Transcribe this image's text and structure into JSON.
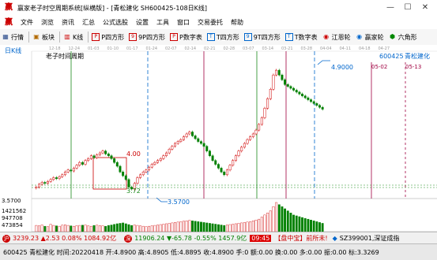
{
  "window": {
    "title": "赢家老子时空周期系统[纵横版] - [青松建化  SH600425-108日K线]"
  },
  "menu": [
    "文件",
    "浏览",
    "资讯",
    "汇总",
    "公式选股",
    "设置",
    "工具",
    "窗口",
    "交易委托",
    "帮助"
  ],
  "toolbar": [
    {
      "label": "行情",
      "icon": "grid-icon"
    },
    {
      "label": "板块",
      "icon": "blocks-icon"
    },
    {
      "label": "K线",
      "icon": "kline-icon"
    },
    {
      "label": "P四方形",
      "icon": "p-square-icon"
    },
    {
      "label": "9P四方形",
      "icon": "9p-square-icon"
    },
    {
      "label": "P数字表",
      "icon": "p-table-icon"
    },
    {
      "label": "T四方形",
      "icon": "t-square-icon"
    },
    {
      "label": "9T四方形",
      "icon": "9t-square-icon"
    },
    {
      "label": "T数字表",
      "icon": "t-table-icon"
    },
    {
      "label": "江恩轮",
      "icon": "gann-wheel-icon"
    },
    {
      "label": "赢家轮",
      "icon": "winner-wheel-icon"
    },
    {
      "label": "六角形",
      "icon": "hexagon-icon"
    }
  ],
  "chart": {
    "period_label": "日K线",
    "cycle_label": "老子时间周期",
    "stock_code": "600425",
    "stock_name": "青松建化",
    "top_dates": [
      "12-18",
      "12-24",
      "01-03",
      "01-10",
      "01-17",
      "01-24",
      "02-07",
      "02-14",
      "02-21",
      "02-28",
      "03-07",
      "03-14",
      "03-21",
      "03-28",
      "04-04",
      "04-11",
      "04-18",
      "04-27"
    ],
    "date_labels": [
      {
        "text": "05-02"
      },
      {
        "text": "05-13"
      }
    ],
    "price_labels": {
      "high": "4.9000",
      "box_top": "4.00",
      "box_bottom": "3.72",
      "low": "3.5700",
      "axis_low": "3.5700"
    },
    "volume_axis": [
      "1421562",
      "947708",
      "473854"
    ]
  },
  "chart_data": {
    "type": "candlestick",
    "x": [
      1,
      2,
      3,
      4,
      5,
      6,
      7,
      8,
      9,
      10,
      11,
      12,
      13,
      14,
      15,
      16,
      17,
      18,
      19,
      20,
      21,
      22,
      23,
      24,
      25,
      26,
      27,
      28,
      29,
      30,
      31,
      32,
      33,
      34,
      35,
      36,
      37,
      38,
      39,
      40,
      41,
      42,
      43,
      44,
      45,
      46,
      47,
      48,
      49,
      50,
      51,
      52,
      53,
      54,
      55,
      56,
      57,
      58,
      59,
      60,
      61,
      62,
      63,
      64,
      65,
      66,
      67,
      68,
      69,
      70,
      71,
      72,
      73,
      74,
      75,
      76,
      77,
      78,
      79,
      80,
      81,
      82,
      83,
      84,
      85,
      86,
      87,
      88,
      89,
      90,
      91,
      92,
      93,
      94,
      95,
      96,
      97,
      98,
      99,
      100
    ],
    "open": [
      3.61,
      3.62,
      3.65,
      3.67,
      3.66,
      3.68,
      3.7,
      3.72,
      3.71,
      3.73,
      3.75,
      3.78,
      3.8,
      3.79,
      3.82,
      3.85,
      3.88,
      3.86,
      3.9,
      3.92,
      3.95,
      3.93,
      3.96,
      3.98,
      4.0,
      3.97,
      3.95,
      3.92,
      3.88,
      3.84,
      3.78,
      3.74,
      3.7,
      3.62,
      3.6,
      3.66,
      3.72,
      3.75,
      3.78,
      3.8,
      3.83,
      3.86,
      3.88,
      3.9,
      3.92,
      3.95,
      3.98,
      4.02,
      4.05,
      4.08,
      4.1,
      4.12,
      4.15,
      4.18,
      4.2,
      4.16,
      4.13,
      4.1,
      4.08,
      4.05,
      4.0,
      3.95,
      3.9,
      3.86,
      3.82,
      3.78,
      3.75,
      3.8,
      3.85,
      3.9,
      3.95,
      4.0,
      4.04,
      4.08,
      4.12,
      4.15,
      4.18,
      4.22,
      4.28,
      4.35,
      4.45,
      4.55,
      4.65,
      4.8,
      4.85,
      4.8,
      4.75,
      4.7,
      4.68,
      4.66,
      4.64,
      4.62,
      4.6,
      4.58,
      4.56,
      4.54,
      4.52,
      4.5,
      4.48,
      4.46
    ],
    "close": [
      3.62,
      3.65,
      3.67,
      3.66,
      3.68,
      3.7,
      3.72,
      3.71,
      3.73,
      3.75,
      3.78,
      3.8,
      3.79,
      3.82,
      3.85,
      3.88,
      3.86,
      3.9,
      3.92,
      3.95,
      3.93,
      3.96,
      3.98,
      4.0,
      3.97,
      3.95,
      3.92,
      3.88,
      3.84,
      3.78,
      3.74,
      3.7,
      3.62,
      3.6,
      3.66,
      3.72,
      3.75,
      3.78,
      3.8,
      3.83,
      3.86,
      3.88,
      3.9,
      3.92,
      3.95,
      3.98,
      4.02,
      4.05,
      4.08,
      4.1,
      4.12,
      4.15,
      4.18,
      4.2,
      4.16,
      4.13,
      4.1,
      4.08,
      4.05,
      4.0,
      3.95,
      3.9,
      3.86,
      3.82,
      3.78,
      3.75,
      3.8,
      3.85,
      3.9,
      3.95,
      4.0,
      4.04,
      4.08,
      4.12,
      4.15,
      4.18,
      4.22,
      4.28,
      4.35,
      4.45,
      4.55,
      4.65,
      4.8,
      4.85,
      4.8,
      4.75,
      4.7,
      4.68,
      4.66,
      4.64,
      4.62,
      4.6,
      4.58,
      4.56,
      4.54,
      4.52,
      4.5,
      4.48,
      4.46,
      4.44
    ],
    "volume": [
      300,
      280,
      320,
      260,
      240,
      350,
      300,
      280,
      260,
      310,
      330,
      300,
      280,
      260,
      290,
      300,
      310,
      320,
      280,
      260,
      300,
      310,
      290,
      280,
      260,
      300,
      320,
      350,
      380,
      400,
      420,
      380,
      340,
      300,
      320,
      300,
      280,
      260,
      240,
      260,
      280,
      300,
      320,
      340,
      360,
      380,
      400,
      420,
      440,
      460,
      480,
      500,
      520,
      540,
      520,
      500,
      480,
      460,
      440,
      420,
      400,
      380,
      360,
      340,
      320,
      300,
      320,
      340,
      360,
      380,
      400,
      420,
      440,
      460,
      480,
      520,
      560,
      600,
      700,
      800,
      900,
      1000,
      1200,
      1400,
      1300,
      1200,
      1100,
      1000,
      900,
      800,
      760,
      720,
      680,
      640,
      600,
      560,
      520,
      480,
      440,
      400
    ],
    "ylim": [
      3.5,
      5.05
    ],
    "annotations": [
      {
        "label": "4.9000",
        "value": 4.9
      },
      {
        "label": "4.00",
        "value": 4.0
      },
      {
        "label": "3.72",
        "value": 3.72
      },
      {
        "label": "3.5700",
        "value": 3.57
      }
    ]
  },
  "status": {
    "sh_index": "3239.23",
    "sh_change": "▲2.53",
    "sh_pct": "0.08%",
    "sh_amount": "1084.92亿",
    "sz_index": "11906.24",
    "sz_change": "▼-65.78",
    "sz_pct": "-0.55%",
    "sz_amount": "1457.9亿",
    "time": "09:45",
    "tag": "【盘中宝】前所未!",
    "ticker": "SZ399001,深证成指"
  },
  "info": {
    "text": "600425 青松建化 时间:20220418 开:4.8900 高:4.8905 低:4.8895 收:4.8900 手:0 额:0.00 换:0.00 多:0.00 振:0.00 标:3.3269"
  }
}
